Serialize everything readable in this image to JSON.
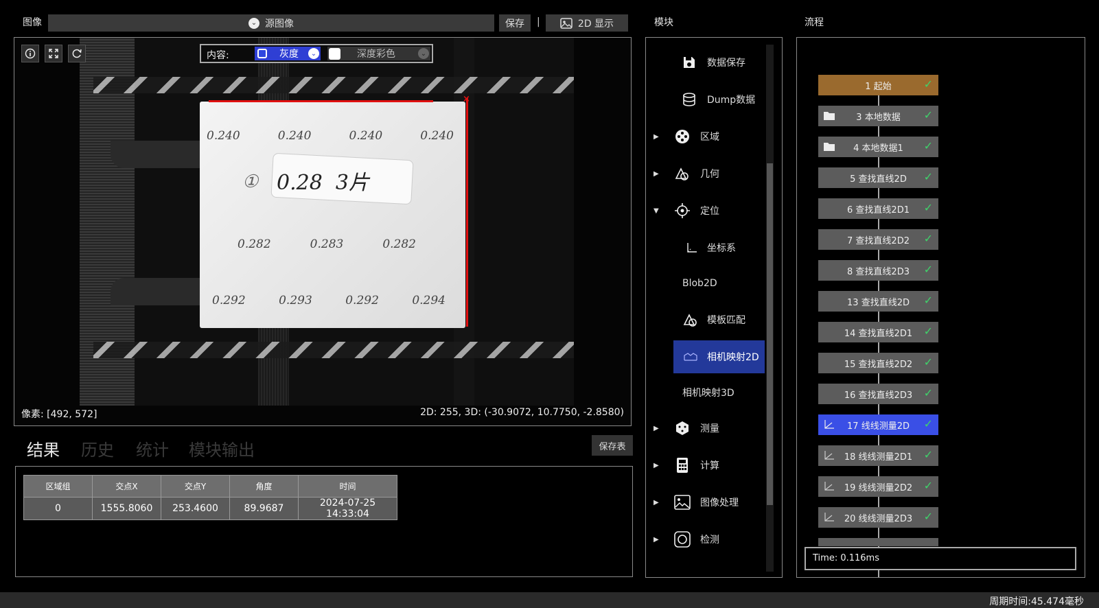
{
  "image_panel": {
    "title": "图像",
    "source_select": "源图像",
    "save_label": "保存",
    "divider": "|",
    "display_label": "2D 显示",
    "content_label": "内容:",
    "content_option_gray": "灰度",
    "content_option_depth": "深度彩色",
    "pixel_readout": "像素: [492, 572]",
    "coord_readout": "2D: 255, 3D: (-30.9072, 10.7750, -2.8580)"
  },
  "photo_text": {
    "row1": [
      "0.240",
      "0.240",
      "0.240",
      "0.240"
    ],
    "label_circle": "①",
    "label_main": "0.28  3片",
    "row2": [
      "0.282",
      "0.283",
      "0.282"
    ],
    "row3": [
      "0.292",
      "0.293",
      "0.292",
      "0.294"
    ]
  },
  "results": {
    "tabs": [
      "结果",
      "历史",
      "统计",
      "模块输出"
    ],
    "save_table_label": "保存表",
    "columns": [
      "区域组",
      "交点X",
      "交点Y",
      "角度",
      "时间"
    ],
    "rows": [
      [
        "0",
        "1555.8060",
        "253.4600",
        "89.9687",
        "2024-07-25 14:33:04"
      ]
    ]
  },
  "modules": {
    "title": "模块",
    "items": [
      {
        "label": "数据保存",
        "icon": "save-icon",
        "arrow": ""
      },
      {
        "label": "Dump数据",
        "icon": "database-icon",
        "arrow": ""
      },
      {
        "label": "区域",
        "icon": "region-icon",
        "arrow": "▶"
      },
      {
        "label": "几何",
        "icon": "geometry-icon",
        "arrow": "▶"
      },
      {
        "label": "定位",
        "icon": "target-icon",
        "arrow": "▼"
      },
      {
        "label": "坐标系",
        "icon": "axis-icon",
        "arrow": ""
      },
      {
        "label": "Blob2D",
        "icon": "",
        "arrow": ""
      },
      {
        "label": "模板匹配",
        "icon": "template-icon",
        "arrow": ""
      },
      {
        "label": "相机映射2D",
        "icon": "camera-map-icon",
        "arrow": ""
      },
      {
        "label": "相机映射3D",
        "icon": "",
        "arrow": ""
      },
      {
        "label": "测量",
        "icon": "measure-icon",
        "arrow": "▶"
      },
      {
        "label": "计算",
        "icon": "calculator-icon",
        "arrow": "▶"
      },
      {
        "label": "图像处理",
        "icon": "image-process-icon",
        "arrow": "▶"
      },
      {
        "label": "检测",
        "icon": "detect-icon",
        "arrow": "▶"
      }
    ]
  },
  "flow": {
    "title": "流程",
    "nodes": [
      {
        "label": "1 起始",
        "status": "✓"
      },
      {
        "label": "3 本地数据",
        "status": "✓"
      },
      {
        "label": "4 本地数据1",
        "status": "✓"
      },
      {
        "label": "5 查找直线2D",
        "status": "✓"
      },
      {
        "label": "6 查找直线2D1",
        "status": "✓"
      },
      {
        "label": "7 查找直线2D2",
        "status": "✓"
      },
      {
        "label": "8 查找直线2D3",
        "status": "✓"
      },
      {
        "label": "13 查找直线2D",
        "status": "✓"
      },
      {
        "label": "14 查找直线2D1",
        "status": "✓"
      },
      {
        "label": "15 查找直线2D2",
        "status": "✓"
      },
      {
        "label": "16 查找直线2D3",
        "status": "✓"
      },
      {
        "label": "17 线线测量2D",
        "status": "✓"
      },
      {
        "label": "18 线线测量2D1",
        "status": "✓"
      },
      {
        "label": "19 线线测量2D2",
        "status": "✓"
      },
      {
        "label": "20 线线测量2D3",
        "status": "✓"
      }
    ],
    "time_label": "Time: 0.116ms"
  },
  "status_bar": {
    "cycle_time": "周期时间:45.474毫秒"
  },
  "colors": {
    "accent_blue": "#2f3fd4",
    "flow_start": "#9a6a2e",
    "flow_selected": "#3a4fe6",
    "check_green": "#3fd26a",
    "measure_line": "#e01010"
  }
}
